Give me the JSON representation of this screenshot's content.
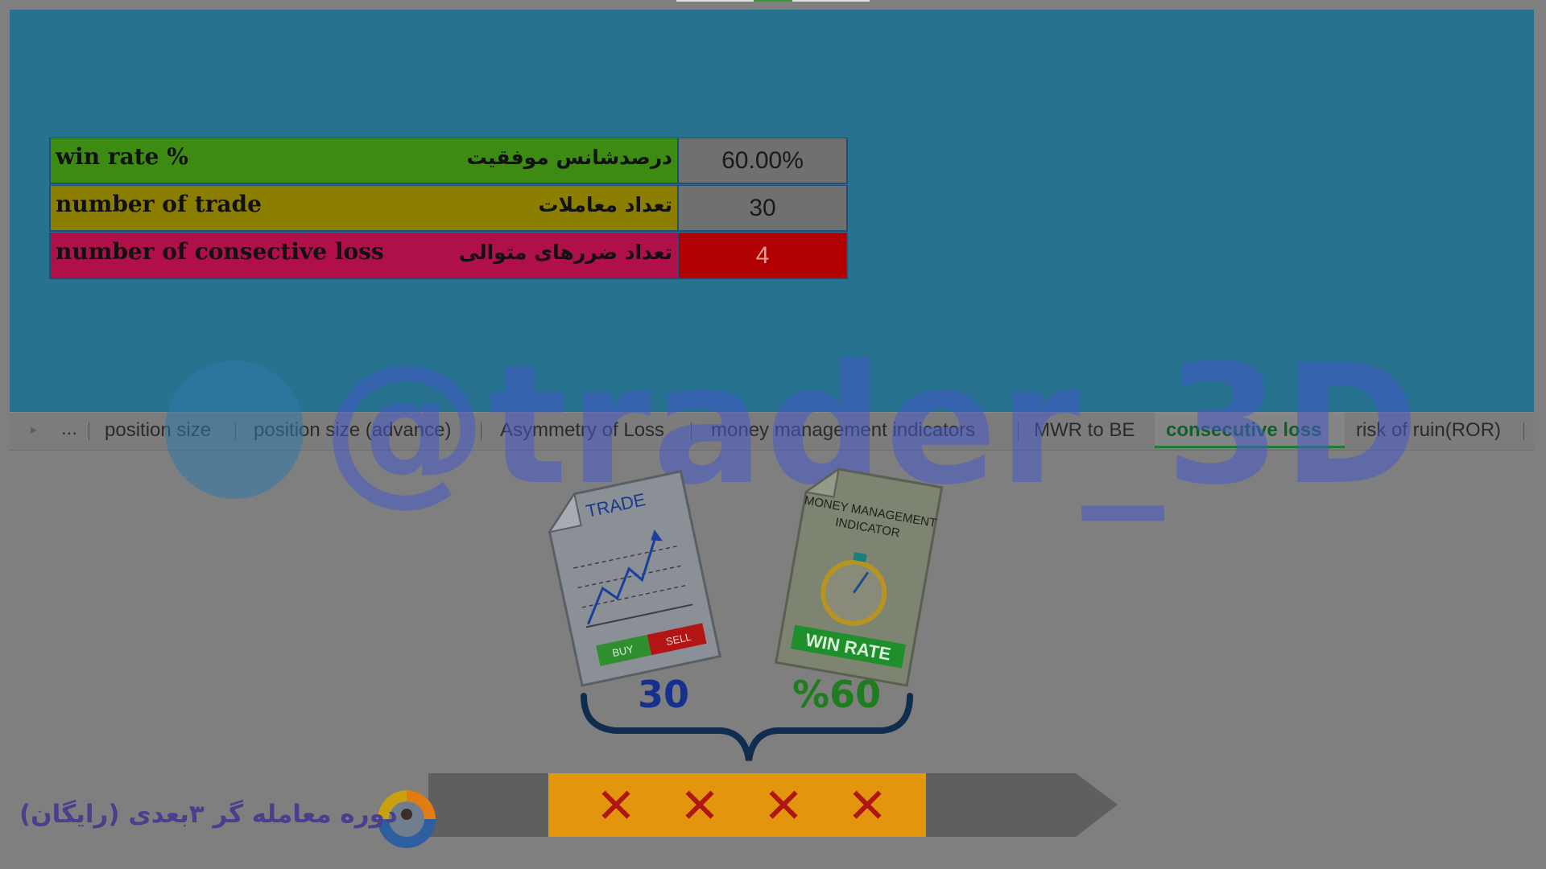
{
  "table": {
    "rows": [
      {
        "en": "win rate %",
        "fa": "درصدشانس موفقیت",
        "value": "60.00%"
      },
      {
        "en": "number of trade",
        "fa": "تعداد معاملات",
        "value": "30"
      },
      {
        "en": "number of consective loss",
        "fa": "تعداد ضررهای متوالی",
        "value": "4"
      }
    ]
  },
  "tabs": {
    "more": "...",
    "items": [
      {
        "label": "position size"
      },
      {
        "label": "position size (advance)"
      },
      {
        "label": "Asymmetry of Loss"
      },
      {
        "label": "money management indicators"
      },
      {
        "label": "MWR to BE"
      },
      {
        "label": "consecutive loss"
      },
      {
        "label": "risk of ruin(ROR)"
      }
    ],
    "active": "consecutive loss"
  },
  "watermark": {
    "text": "@trader_3D"
  },
  "illustration": {
    "trade_doc": {
      "title": "TRADE",
      "buy": "BUY",
      "sell": "SELL"
    },
    "mm_doc": {
      "title_line1": "MONEY MANAGEMENT",
      "title_line2": "INDICATOR",
      "banner": "WIN RATE"
    },
    "trade_count": "30",
    "win_rate": "%60",
    "losses": [
      "✕",
      "✕",
      "✕",
      "✕"
    ]
  },
  "footer": {
    "course_label": "دوره معامله گر ۳بعدی (رایگان)"
  },
  "colors": {
    "sheet_bg": "#26728f",
    "row1": "#3e8b14",
    "row2": "#8c7f00",
    "row3": "#b0104a",
    "loss_value_bg": "#b00000",
    "timeline_orange": "#e3950d",
    "timeline_gray": "#5f5f5f",
    "active_tab": "#0f5f2c"
  }
}
